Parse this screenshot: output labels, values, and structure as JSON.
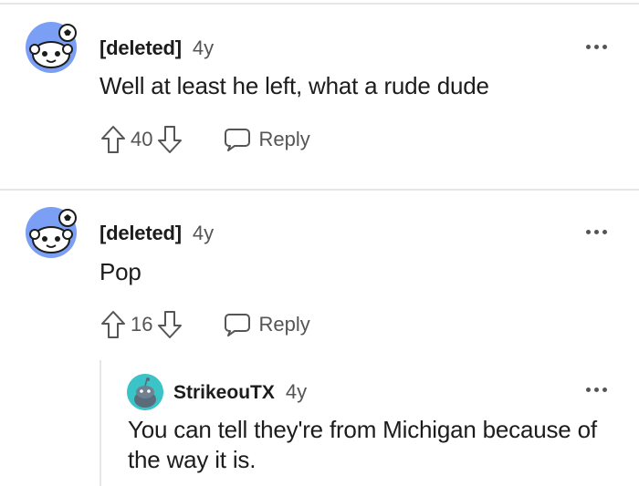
{
  "comments": [
    {
      "author": "[deleted]",
      "age": "4y",
      "body": "Well at least he left, what a rude dude",
      "score": "40",
      "reply_label": "Reply"
    },
    {
      "author": "[deleted]",
      "age": "4y",
      "body": "Pop",
      "score": "16",
      "reply_label": "Reply",
      "replies": [
        {
          "author": "StrikeouTX",
          "age": "4y",
          "body": "You can tell they're from Michigan because of the way it is."
        }
      ]
    }
  ],
  "icons": {
    "avatar": "snoo-soccer-avatar-icon",
    "small_avatar": "snoo-avatar-icon",
    "upvote": "arrow-up-icon",
    "downvote": "arrow-down-icon",
    "reply": "speech-bubble-icon",
    "more": "more-options-icon"
  },
  "colors": {
    "avatar_bg": "#7b9ff5",
    "small_avatar_bg": "#3bc4c8",
    "text": "#1c1c1c",
    "muted": "#555555",
    "divider": "#e6e6e6"
  }
}
